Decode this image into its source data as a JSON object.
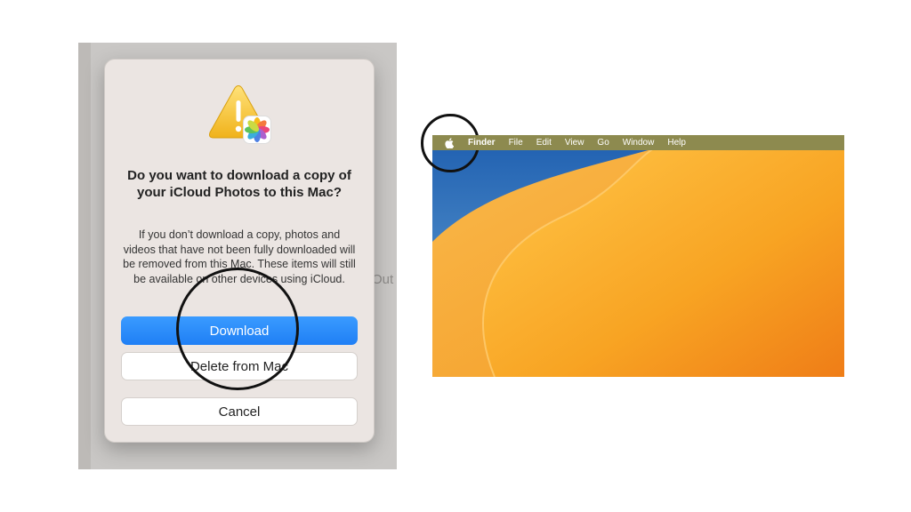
{
  "dialog": {
    "title": "Do you want to download a copy of your iCloud Photos to this Mac?",
    "body": "If you don’t download a copy, photos and videos that have not been fully downloaded will be removed from this Mac. These items will still be available on other devices using iCloud.",
    "buttons": {
      "download": "Download",
      "delete": "Delete from Mac",
      "cancel": "Cancel"
    },
    "icons": [
      "warning-icon",
      "photos-app-icon"
    ]
  },
  "background_text": "Out",
  "menubar": {
    "apple_icon": "apple-logo-icon",
    "items": [
      "Finder",
      "File",
      "Edit",
      "View",
      "Go",
      "Window",
      "Help"
    ]
  },
  "colors": {
    "primary_button": "#1f7ff5",
    "menubar": "#8d8a4f",
    "wallpaper_orange": "#f5a623",
    "wallpaper_blue": "#2c79c6"
  }
}
